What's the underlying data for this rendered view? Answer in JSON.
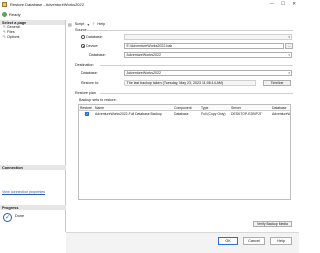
{
  "window": {
    "title": "Restore Database - AdventureWorks2022",
    "controls": [
      "—",
      "☐",
      "✕"
    ]
  },
  "status": {
    "text": "Ready"
  },
  "sidebar": {
    "select_page_header": "Select a page",
    "items": [
      {
        "label": "General",
        "icon": "wrench-icon"
      },
      {
        "label": "Files",
        "icon": "wrench-icon"
      },
      {
        "label": "Options",
        "icon": "wrench-icon"
      }
    ],
    "connection_header": "Connection",
    "connection_link": "View connection properties",
    "progress_header": "Progress",
    "progress_status": "Done"
  },
  "toolbar": {
    "script_label": "Script",
    "help_label": "Help"
  },
  "source": {
    "group_label": "Source",
    "database_radio": "Database:",
    "device_radio": "Device:",
    "device_value": "E:\\AdventureWorks2022.bak",
    "device_browse": "...",
    "database_label": "Database:",
    "database_value": "AdventureWorks2022"
  },
  "destination": {
    "group_label": "Destination",
    "database_label": "Database:",
    "database_value": "AdventureWorks2022",
    "restore_to_label": "Restore to:",
    "restore_to_value": "The last backup taken (Tuesday, May 23, 2023 11:06:14 AM)",
    "timeline_button": "Timeline"
  },
  "restore_plan": {
    "group_label": "Restore plan",
    "backup_sets_label": "Backup sets to restore:",
    "columns": [
      "Restore",
      "Name",
      "Component",
      "Type",
      "Server",
      "Database"
    ],
    "rows": [
      {
        "restore": true,
        "name": "AdventureWorks2022-Full Database Backup",
        "component": "Database",
        "type": "Full (Copy Only)",
        "server": "DESKTOP-E2BIPJT",
        "database": "AdventureW"
      }
    ],
    "verify_button": "Verify Backup Media"
  },
  "buttons": {
    "ok": "OK",
    "cancel": "Cancel",
    "help": "Help"
  }
}
